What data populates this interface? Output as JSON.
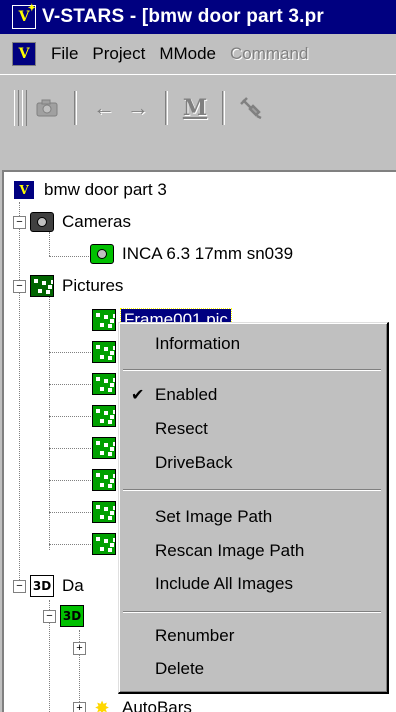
{
  "window": {
    "title": "V-STARS - [bmw door part 3.pr",
    "app_icon_glyph": "V"
  },
  "menubar": {
    "items": [
      {
        "label": "File",
        "enabled": true
      },
      {
        "label": "Project",
        "enabled": true
      },
      {
        "label": "MMode",
        "enabled": true
      },
      {
        "label": "Command",
        "enabled": false
      }
    ]
  },
  "toolbar": {
    "buttons": [
      {
        "icon": "camera-icon"
      },
      {
        "icon": "arrow-left-icon",
        "glyph": "←"
      },
      {
        "icon": "arrow-right-icon",
        "glyph": "→"
      },
      {
        "icon": "m-icon",
        "glyph": "M"
      },
      {
        "icon": "satellite-icon"
      }
    ]
  },
  "tree": {
    "root": "bmw door part 3",
    "cameras_label": "Cameras",
    "camera_item": "INCA 6.3 17mm sn039",
    "pictures_label": "Pictures",
    "selected_picture": "Frame001.pic",
    "data_label": "Da",
    "autobars_label": "AutoBars"
  },
  "context_menu": {
    "information": "Information",
    "enabled": "Enabled",
    "enabled_checked": true,
    "resect": "Resect",
    "driveback": "DriveBack",
    "set_image_path": "Set Image Path",
    "rescan_image_path": "Rescan Image Path",
    "include_all_images": "Include All Images",
    "renumber": "Renumber",
    "delete": "Delete",
    "check_glyph": "✔"
  },
  "colors": {
    "titlebar": "#000080",
    "face": "#c0c0c0",
    "selection": "#000080",
    "picture_green": "#006400"
  }
}
